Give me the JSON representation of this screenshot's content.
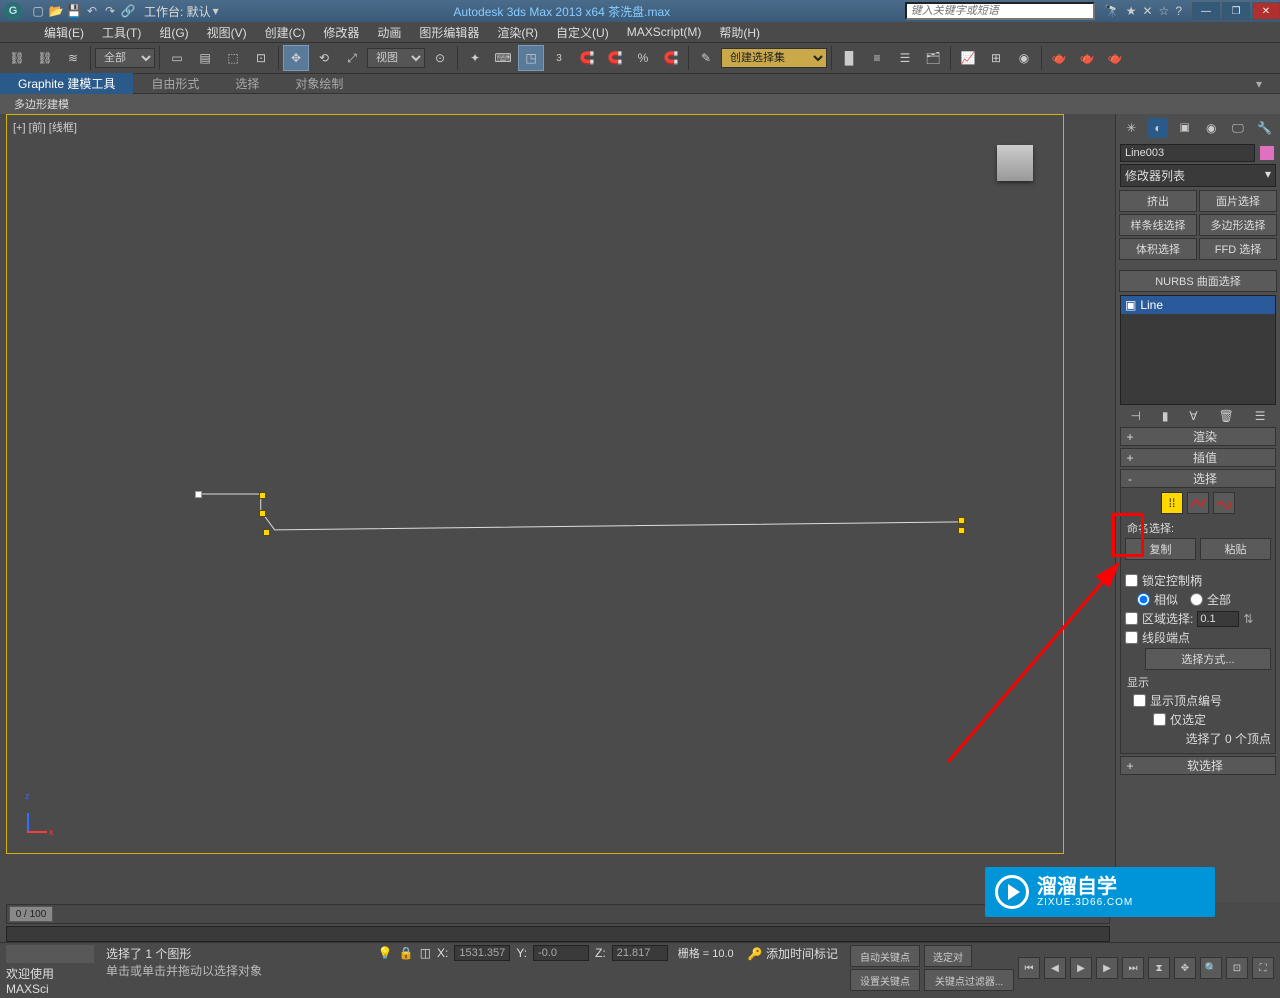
{
  "titlebar": {
    "workspace_label": "工作台: 默认",
    "title": "Autodesk 3ds Max  2013 x64   茶洗盘.max",
    "search_placeholder": "键入关键字或短语"
  },
  "menu": [
    "编辑(E)",
    "工具(T)",
    "组(G)",
    "视图(V)",
    "创建(C)",
    "修改器",
    "动画",
    "图形编辑器",
    "渲染(R)",
    "自定义(U)",
    "MAXScript(M)",
    "帮助(H)"
  ],
  "toolbar": {
    "filter": "全部",
    "refsys": "视图",
    "named_sel": "创建选择集"
  },
  "ribbon": {
    "tabs": [
      "Graphite 建模工具",
      "自由形式",
      "选择",
      "对象绘制"
    ],
    "sub": "多边形建模"
  },
  "viewport": {
    "label": "[+] [前] [线框]"
  },
  "command_panel": {
    "object_name": "Line003",
    "modifier_list": "修改器列表",
    "btns": [
      "挤出",
      "面片选择",
      "样条线选择",
      "多边形选择",
      "体积选择",
      "FFD 选择",
      "",
      "NURBS 曲面选择"
    ],
    "stack_item": "Line",
    "rollouts": {
      "render": "渲染",
      "interp": "插值",
      "selection": "选择",
      "soft": "软选择"
    },
    "selection_panel": {
      "named_sel": "命名选择:",
      "copy": "复制",
      "paste": "粘贴",
      "lock_handles": "锁定控制柄",
      "similar": "相似",
      "all": "全部",
      "area_sel": "区域选择:",
      "area_val": "0.1",
      "seg_end": "线段端点",
      "sel_method": "选择方式...",
      "display": "显示",
      "show_vert_num": "显示顶点编号",
      "only_sel": "仅选定",
      "status": "选择了 0 个顶点"
    }
  },
  "timeline": {
    "slider": "0 / 100"
  },
  "status": {
    "welcome": "欢迎使用  MAXSci",
    "sel_info": "选择了 1 个图形",
    "prompt": "单击或单击并拖动以选择对象",
    "x": "1531.357",
    "y": "-0.0",
    "z": "21.817",
    "grid": "栅格 = 10.0",
    "autokey": "自动关键点",
    "setkey": "设置关键点",
    "selset": "选定对",
    "keyfilter": "关键点过滤器...",
    "addtime": "添加时间标记"
  },
  "watermark": {
    "brand": "溜溜自学",
    "url": "ZIXUE.3D66.COM"
  }
}
